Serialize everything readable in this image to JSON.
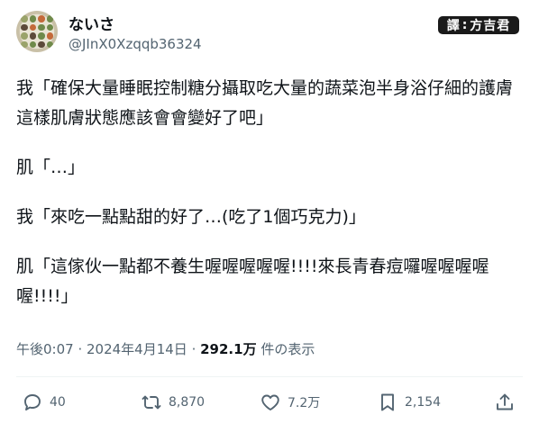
{
  "author": {
    "name": "ないさ",
    "handle": "@JInX0Xzqqb36324"
  },
  "badge": {
    "left": "譯",
    "right": "方吉君"
  },
  "tweet": {
    "paragraphs": [
      "我「確保大量睡眠控制糖分攝取吃大量的蔬菜泡半身浴仔細的護膚這樣肌膚狀態應該會會變好了吧」",
      "肌「…」",
      "我「來吃一點點甜的好了…(吃了1個巧克力)」",
      "肌「這傢伙一點都不養生喔喔喔喔喔!!!!來長青春痘囉喔喔喔喔喔!!!!」"
    ]
  },
  "meta": {
    "time": "午後0:07",
    "sep1": " · ",
    "date": "2024年4月14日",
    "sep2": " · ",
    "views": "292.1万",
    "views_suffix": " 件の表示"
  },
  "actions": {
    "reply": {
      "icon": "reply-icon",
      "count": "40"
    },
    "repost": {
      "icon": "repost-icon",
      "count": "8,870"
    },
    "like": {
      "icon": "heart-icon",
      "count": "7.2万"
    },
    "bookmark": {
      "icon": "bookmark-icon",
      "count": "2,154"
    },
    "share": {
      "icon": "share-icon"
    }
  },
  "colors": {
    "text": "#0f1419",
    "secondary": "#536471",
    "divider": "#eff3f4"
  }
}
